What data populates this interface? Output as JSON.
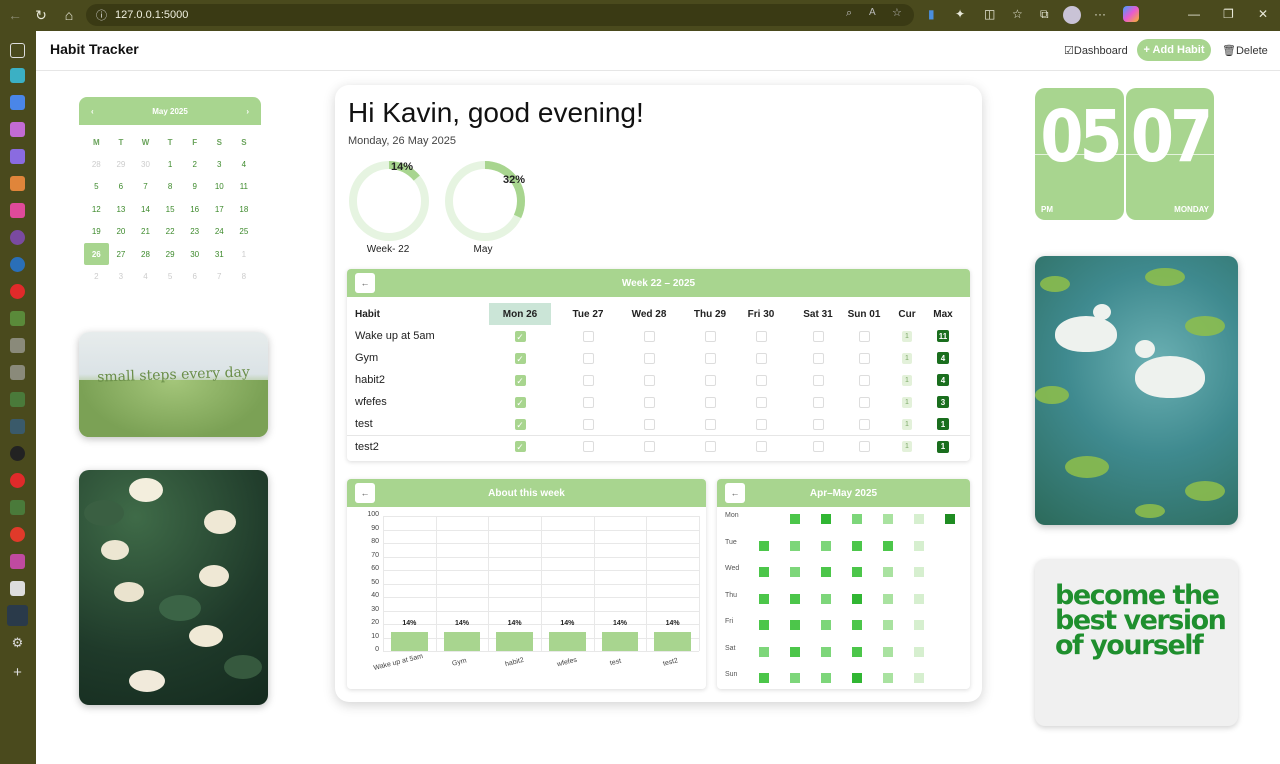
{
  "browser": {
    "url": "127.0.0.1:5000"
  },
  "header": {
    "brand": "Habit Tracker",
    "dashboard_label": "Dashboard",
    "add_label": "+ Add Habit",
    "delete_label": "Delete"
  },
  "calendar": {
    "month_label": "May 2025",
    "dows": [
      "M",
      "T",
      "W",
      "T",
      "F",
      "S",
      "S"
    ],
    "weeks": [
      [
        "28",
        "29",
        "30",
        "1",
        "2",
        "3",
        "4"
      ],
      [
        "5",
        "6",
        "7",
        "8",
        "9",
        "10",
        "11"
      ],
      [
        "12",
        "13",
        "14",
        "15",
        "16",
        "17",
        "18"
      ],
      [
        "19",
        "20",
        "21",
        "22",
        "23",
        "24",
        "25"
      ],
      [
        "26",
        "27",
        "28",
        "29",
        "30",
        "31",
        "1"
      ],
      [
        "2",
        "3",
        "4",
        "5",
        "6",
        "7",
        "8"
      ]
    ],
    "today": "26"
  },
  "images": {
    "steps_caption": "small steps every day"
  },
  "clock": {
    "hour": "05",
    "minute": "07",
    "ampm": "PM",
    "day": "MONDAY"
  },
  "quote": "become the best version of yourself",
  "main": {
    "greeting": "Hi Kavin, good evening!",
    "date": "Monday, 26 May 2025",
    "rings": [
      {
        "label": "Week- 22",
        "pct_text": "14%",
        "value": 0.14
      },
      {
        "label": "May",
        "pct_text": "32%",
        "value": 0.32
      }
    ]
  },
  "week": {
    "title": "Week 22 – 2025",
    "back_label": "←",
    "columns": [
      "Habit",
      "Mon 26",
      "Tue 27",
      "Wed 28",
      "Thu 29",
      "Fri 30",
      "Sat 31",
      "Sun 01",
      "Cur",
      "Max"
    ],
    "rows": [
      {
        "name": "Wake up at 5am",
        "done": [
          true,
          false,
          false,
          false,
          false,
          false,
          false
        ],
        "cur": "1",
        "max": "11"
      },
      {
        "name": "Gym",
        "done": [
          true,
          false,
          false,
          false,
          false,
          false,
          false
        ],
        "cur": "1",
        "max": "4"
      },
      {
        "name": "habit2",
        "done": [
          true,
          false,
          false,
          false,
          false,
          false,
          false
        ],
        "cur": "1",
        "max": "4"
      },
      {
        "name": "wfefes",
        "done": [
          true,
          false,
          false,
          false,
          false,
          false,
          false
        ],
        "cur": "1",
        "max": "3"
      },
      {
        "name": "test",
        "done": [
          true,
          false,
          false,
          false,
          false,
          false,
          false
        ],
        "cur": "1",
        "max": "1"
      },
      {
        "name": "test2",
        "done": [
          true,
          false,
          false,
          false,
          false,
          false,
          false
        ],
        "cur": "1",
        "max": "1"
      }
    ]
  },
  "about_week": {
    "title": "About this week",
    "back_label": "←"
  },
  "chart_data": {
    "type": "bar",
    "categories": [
      "Wake up at 5am",
      "Gym",
      "habit2",
      "wfefes",
      "test",
      "test2"
    ],
    "values": [
      14,
      14,
      14,
      14,
      14,
      14
    ],
    "data_labels": [
      "14%",
      "14%",
      "14%",
      "14%",
      "14%",
      "14%"
    ],
    "ylim": [
      0,
      100
    ],
    "yticks": [
      0,
      10,
      20,
      30,
      40,
      50,
      60,
      70,
      80,
      90,
      100
    ],
    "grid": true,
    "bar_color": "#a8d58f"
  },
  "heatmap": {
    "title": "Apr–May 2025",
    "back_label": "←",
    "days": [
      "Mon",
      "Tue",
      "Wed",
      "Thu",
      "Fri",
      "Sat",
      "Sun"
    ],
    "levels": [
      [
        null,
        3,
        4,
        2,
        1,
        0,
        5
      ],
      [
        3,
        2,
        2,
        3,
        3,
        0,
        null
      ],
      [
        3,
        2,
        3,
        3,
        1,
        0,
        null
      ],
      [
        3,
        3,
        2,
        4,
        1,
        0,
        null
      ],
      [
        3,
        3,
        2,
        3,
        1,
        0,
        null
      ],
      [
        2,
        3,
        2,
        3,
        1,
        0,
        null
      ],
      [
        3,
        2,
        2,
        4,
        1,
        0,
        null
      ]
    ],
    "colors": [
      "#d6efcf",
      "#a9e2a0",
      "#7dd67a",
      "#4cc64a",
      "#31b633",
      "#1f8c22"
    ]
  },
  "colors": {
    "accent": "#a8d58f",
    "chrome": "#4a4a1d",
    "dark_green": "#1a6e1e"
  }
}
